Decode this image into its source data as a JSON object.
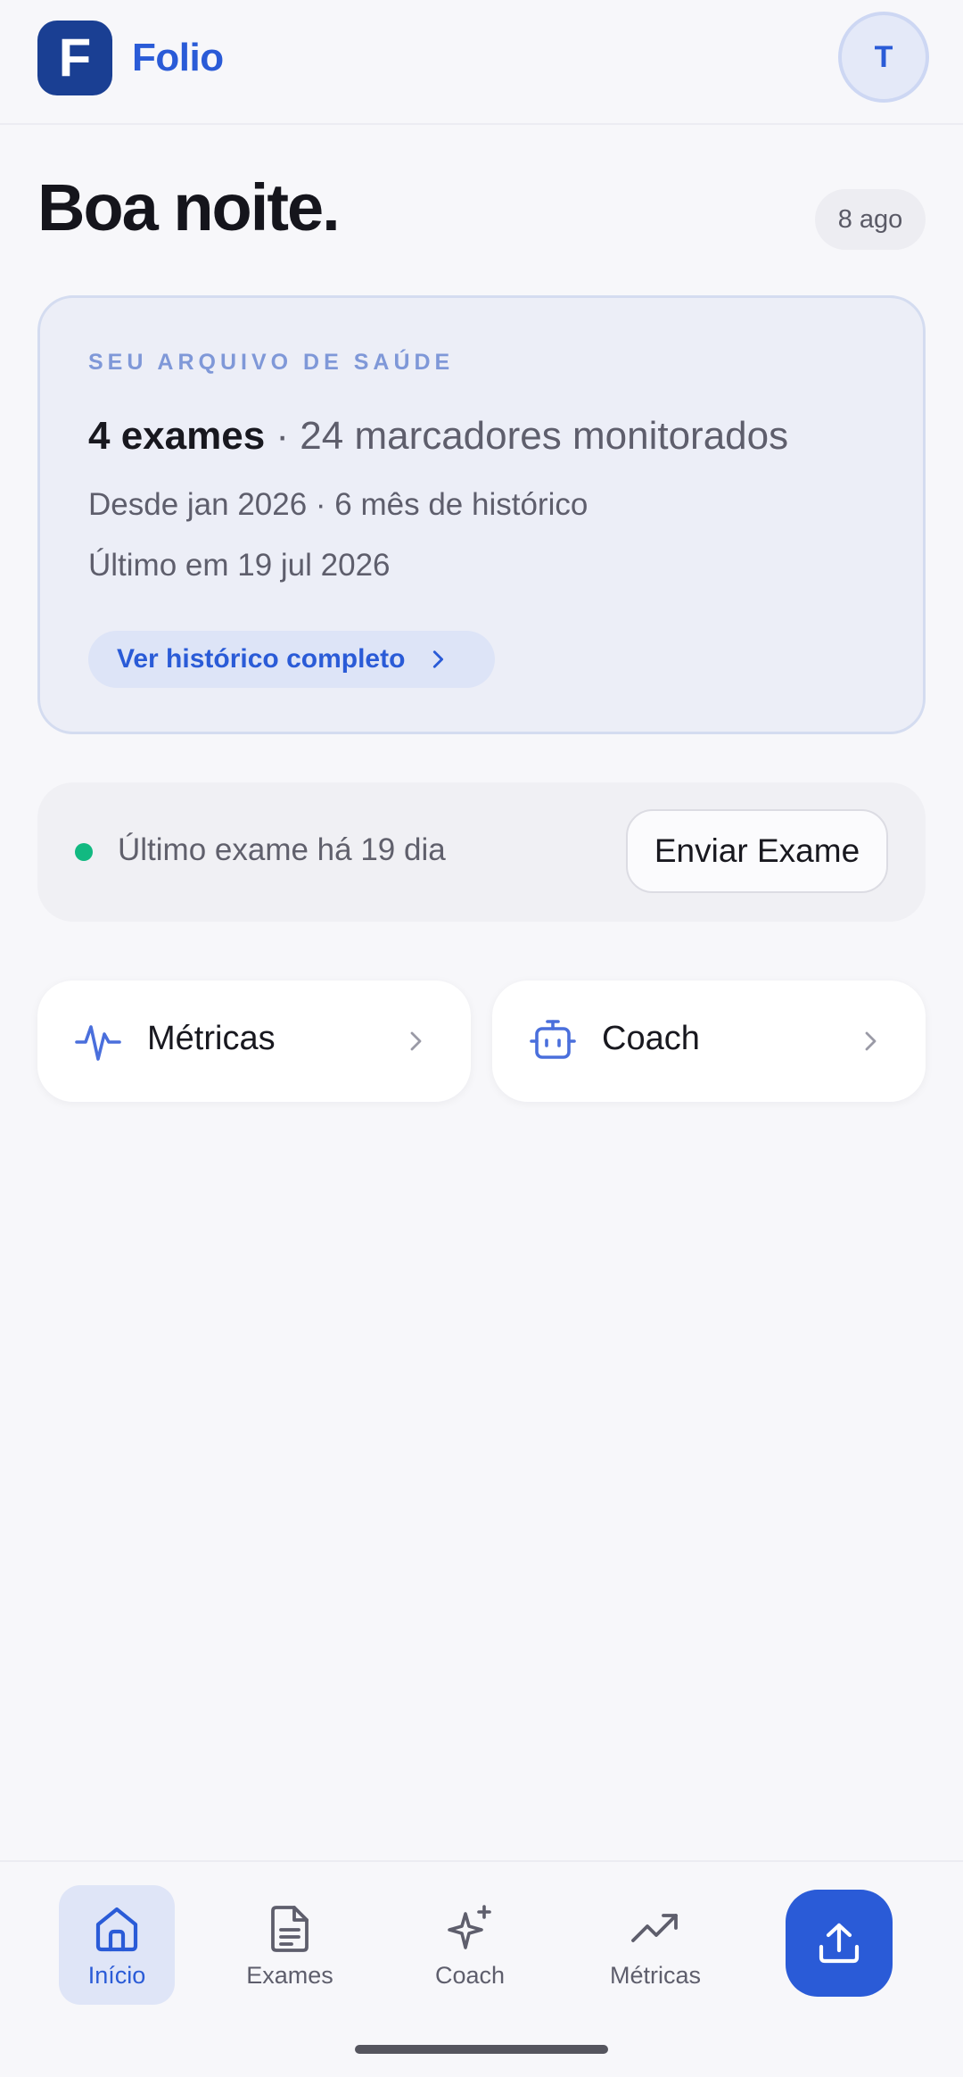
{
  "header": {
    "logo_letter": "F",
    "brand": "Folio",
    "avatar_initial": "T"
  },
  "greeting": {
    "title": "Boa noite.",
    "date": "8 ago"
  },
  "archive_card": {
    "kicker": "SEU ARQUIVO DE SAÚDE",
    "exams_count": "4 exames",
    "markers": " · 24 marcadores monitorados",
    "since": "Desde jan 2026 · 6 mês de histórico",
    "last": "Último em 19 jul 2026",
    "history_button": "Ver histórico completo"
  },
  "status_card": {
    "status_text": "Último exame há 19 dia",
    "status_color": "#12b981",
    "send_button": "Enviar Exame"
  },
  "quick_cards": {
    "metrics": {
      "label": "Métricas",
      "icon": "pulse-icon"
    },
    "coach": {
      "label": "Coach",
      "icon": "robot-icon"
    }
  },
  "bottom_nav": {
    "items": [
      {
        "label": "Início",
        "icon": "home-icon",
        "active": true
      },
      {
        "label": "Exames",
        "icon": "document-icon",
        "active": false
      },
      {
        "label": "Coach",
        "icon": "sparkle-icon",
        "active": false
      },
      {
        "label": "Métricas",
        "icon": "trending-up-icon",
        "active": false
      }
    ],
    "upload_icon": "upload-icon"
  },
  "colors": {
    "accent": "#2a5bd7",
    "logo_bg": "#1a3f93",
    "background": "#f7f7fa"
  }
}
